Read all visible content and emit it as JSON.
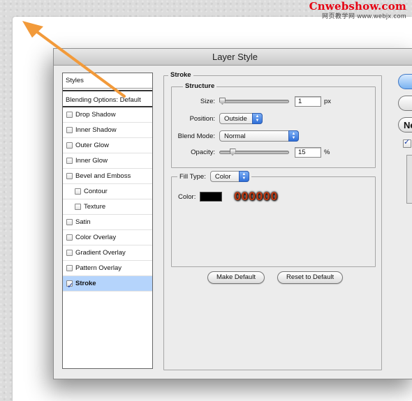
{
  "watermark": {
    "site": "Cnwebshow.com",
    "sub": "网页教学网 www.webjx.com"
  },
  "dialog": {
    "title": "Layer Style",
    "styles_list": {
      "header": "Styles",
      "blending": "Blending Options: Default",
      "items": [
        {
          "label": "Drop Shadow",
          "checked": false
        },
        {
          "label": "Inner Shadow",
          "checked": false
        },
        {
          "label": "Outer Glow",
          "checked": false
        },
        {
          "label": "Inner Glow",
          "checked": false
        },
        {
          "label": "Bevel and Emboss",
          "checked": false
        },
        {
          "label": "Contour",
          "checked": false
        },
        {
          "label": "Texture",
          "checked": false
        },
        {
          "label": "Satin",
          "checked": false
        },
        {
          "label": "Color Overlay",
          "checked": false
        },
        {
          "label": "Gradient Overlay",
          "checked": false
        },
        {
          "label": "Pattern Overlay",
          "checked": false
        },
        {
          "label": "Stroke",
          "checked": true
        }
      ]
    },
    "stroke": {
      "group_title": "Stroke",
      "structure_title": "Structure",
      "size": {
        "label": "Size:",
        "value": "1",
        "unit": "px",
        "slider_level": 0.01
      },
      "position": {
        "label": "Position:",
        "value": "Outside"
      },
      "blend_mode": {
        "label": "Blend Mode:",
        "value": "Normal"
      },
      "opacity": {
        "label": "Opacity:",
        "value": "15",
        "unit": "%",
        "slider_level": 0.15
      },
      "fill_type": {
        "label": "Fill Type:",
        "value": "Color"
      },
      "color": {
        "label": "Color:",
        "swatch": "#000000",
        "hex_annotation": "000000"
      },
      "make_default": "Make Default",
      "reset_default": "Reset to Default"
    },
    "side_buttons": {
      "new_style_partial": "Ne"
    }
  },
  "colors": {
    "selection": "#b5d4fc",
    "arrow": "#f29a3a"
  }
}
